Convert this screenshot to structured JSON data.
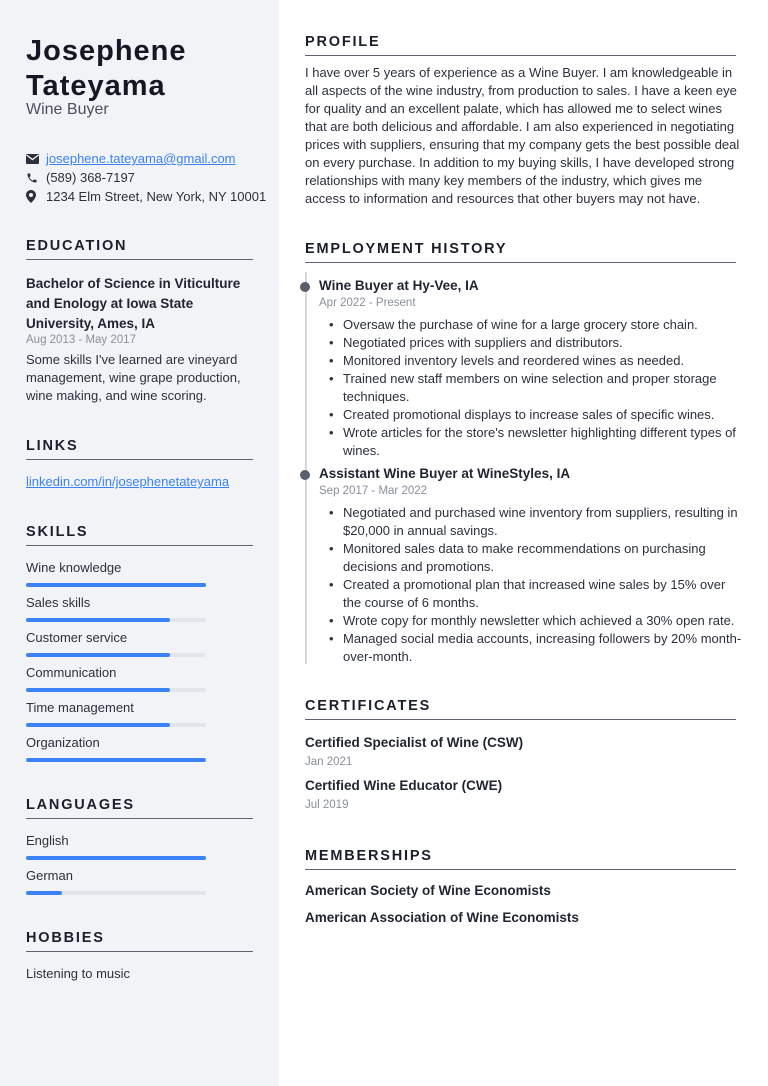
{
  "header": {
    "name": "Josephene Tateyama",
    "title": "Wine Buyer"
  },
  "contact": {
    "email": "josephene.tateyama@gmail.com",
    "phone": "(589) 368-7197",
    "address": "1234 Elm Street, New York, NY 10001",
    "icons": [
      "envelope-icon",
      "phone-icon",
      "location-pin-icon"
    ]
  },
  "education": {
    "heading": "EDUCATION",
    "degree": "Bachelor of Science in Viticulture and Enology at Iowa State University, Ames, IA",
    "dates": "Aug 2013 - May 2017",
    "description": "Some skills I've learned are vineyard management, wine grape production, wine making, and wine scoring."
  },
  "links": {
    "heading": "LINKS",
    "items": [
      {
        "label": "linkedin.com/in/josephenetateyama"
      }
    ]
  },
  "skills": {
    "heading": "SKILLS",
    "items": [
      {
        "label": "Wine knowledge",
        "level": 1.0
      },
      {
        "label": "Sales skills",
        "level": 0.8
      },
      {
        "label": "Customer service",
        "level": 0.8
      },
      {
        "label": "Communication",
        "level": 0.8
      },
      {
        "label": "Time management",
        "level": 0.8
      },
      {
        "label": "Organization",
        "level": 1.0
      }
    ]
  },
  "languages": {
    "heading": "LANGUAGES",
    "items": [
      {
        "label": "English",
        "level": 1.0
      },
      {
        "label": "German",
        "level": 0.2
      }
    ]
  },
  "hobbies": {
    "heading": "HOBBIES",
    "items": [
      "Listening to music"
    ]
  },
  "profile": {
    "heading": "PROFILE",
    "text": "I have over 5 years of experience as a Wine Buyer. I am knowledgeable in all aspects of the wine industry, from production to sales. I have a keen eye for quality and an excellent palate, which has allowed me to select wines that are both delicious and affordable. I am also experienced in negotiating prices with suppliers, ensuring that my company gets the best possible deal on every purchase. In addition to my buying skills, I have developed strong relationships with many key members of the industry, which gives me access to information and resources that other buyers may not have."
  },
  "employment": {
    "heading": "EMPLOYMENT HISTORY",
    "jobs": [
      {
        "title": "Wine Buyer at Hy-Vee, IA",
        "dates": "Apr 2022 - Present",
        "bullets": [
          "Oversaw the purchase of wine for a large grocery store chain.",
          "Negotiated prices with suppliers and distributors.",
          "Monitored inventory levels and reordered wines as needed.",
          "Trained new staff members on wine selection and proper storage techniques.",
          "Created promotional displays to increase sales of specific wines.",
          "Wrote articles for the store's newsletter highlighting different types of wines."
        ]
      },
      {
        "title": "Assistant Wine Buyer at WineStyles, IA",
        "dates": "Sep 2017 - Mar 2022",
        "bullets": [
          "Negotiated and purchased wine inventory from suppliers, resulting in $20,000 in annual savings.",
          "Monitored sales data to make recommendations on purchasing decisions and promotions.",
          "Created a promotional plan that increased wine sales by 15% over the course of 6 months.",
          "Wrote copy for monthly newsletter which achieved a 30% open rate.",
          "Managed social media accounts, increasing followers by 20% month-over-month."
        ]
      }
    ]
  },
  "certificates": {
    "heading": "CERTIFICATES",
    "items": [
      {
        "title": "Certified Specialist of Wine (CSW)",
        "date": "Jan 2021"
      },
      {
        "title": "Certified Wine Educator (CWE)",
        "date": "Jul 2019"
      }
    ]
  },
  "memberships": {
    "heading": "MEMBERSHIPS",
    "items": [
      "American Society of Wine Economists",
      "American Association of Wine Economists"
    ]
  },
  "colors": {
    "accent": "#3b82f6",
    "sidebar_bg": "#f2f3f6",
    "bar_track": "#e3e5ea",
    "heading_rule": "#5f6470",
    "timeline_dot": "#5a5f6b"
  }
}
